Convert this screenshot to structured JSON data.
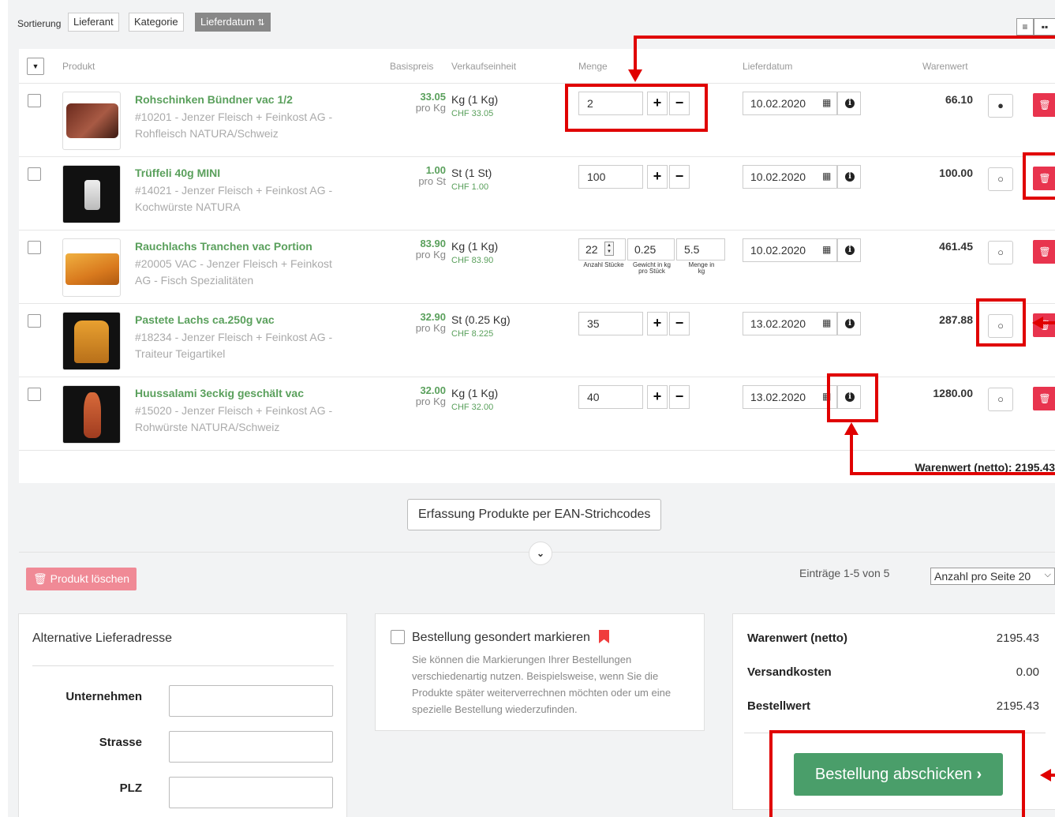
{
  "sort": {
    "label": "Sortierung",
    "buttons": [
      "Lieferant",
      "Kategorie",
      "Lieferdatum"
    ],
    "active_icon": "sort-asc-icon"
  },
  "table": {
    "headers": {
      "product": "Produkt",
      "base_price": "Basispreis",
      "sales_unit": "Verkaufseinheit",
      "quantity": "Menge",
      "delivery_date": "Lieferdatum",
      "goods_value": "Warenwert"
    },
    "rows": [
      {
        "name": "Rohschinken Bündner vac 1/2",
        "desc": "#10201 - Jenzer Fleisch + Feinkost AG - Rohfleisch NATURA/Schweiz",
        "price": "33.05",
        "price_unit": "pro Kg",
        "unit": "Kg (1 Kg)",
        "unit_chf": "CHF 33.05",
        "qty": "2",
        "date": "10.02.2020",
        "value": "66.10",
        "comment": "filled"
      },
      {
        "name": "Trüffeli 40g MINI",
        "desc": "#14021 - Jenzer Fleisch + Feinkost AG - Kochwürste NATURA",
        "price": "1.00",
        "price_unit": "pro St",
        "unit": "St (1 St)",
        "unit_chf": "CHF 1.00",
        "qty": "100",
        "date": "10.02.2020",
        "value": "100.00",
        "comment": "empty"
      },
      {
        "name": "Rauchlachs Tranchen vac Portion",
        "desc": "#20005 VAC - Jenzer Fleisch + Feinkost AG - Fisch Spezialitäten",
        "price": "83.90",
        "price_unit": "pro Kg",
        "unit": "Kg (1 Kg)",
        "unit_chf": "CHF 83.90",
        "qty_pieces": "22",
        "qty_weight": "0.25",
        "qty_kg": "5.5",
        "lbl_pieces": "Anzahl Stücke",
        "lbl_weight": "Gewicht in kg pro Stück",
        "lbl_kg": "Menge in kg",
        "date": "10.02.2020",
        "value": "461.45",
        "comment": "empty"
      },
      {
        "name": "Pastete Lachs ca.250g vac",
        "desc": "#18234 - Jenzer Fleisch + Feinkost AG - Traiteur Teigartikel",
        "price": "32.90",
        "price_unit": "pro Kg",
        "unit": "St (0.25 Kg)",
        "unit_chf": "CHF 8.225",
        "qty": "35",
        "date": "13.02.2020",
        "value": "287.88",
        "comment": "empty"
      },
      {
        "name": "Huussalami 3eckig geschält vac",
        "desc": "#15020 - Jenzer Fleisch + Feinkost AG - Rohwürste NATURA/Schweiz",
        "price": "32.00",
        "price_unit": "pro Kg",
        "unit": "Kg (1 Kg)",
        "unit_chf": "CHF 32.00",
        "qty": "40",
        "date": "13.02.2020",
        "value": "1280.00",
        "comment": "empty"
      }
    ],
    "total_label": "Warenwert (netto): 2195.43"
  },
  "ean_button": "Erfassung Produkte per EAN-Strichcodes",
  "delete_button": "Produkt löschen",
  "entries_info": "Einträge 1-5 von 5",
  "per_page": "Anzahl pro Seite 20",
  "address": {
    "title": "Alternative Lieferadresse",
    "fields": [
      "Unternehmen",
      "Strasse",
      "PLZ"
    ]
  },
  "mark": {
    "label": "Bestellung gesondert markieren",
    "text": "Sie können die Markierungen Ihrer Bestellungen verschiedenartig nutzen. Beispielsweise, wenn Sie die Produkte später weiterverrechnen möchten oder um eine spezielle Bestellung wiederzufinden."
  },
  "summary": {
    "rows": [
      {
        "label": "Warenwert (netto)",
        "value": "2195.43"
      },
      {
        "label": "Versandkosten",
        "value": "0.00"
      },
      {
        "label": "Bestellwert",
        "value": "2195.43"
      }
    ],
    "submit": "Bestellung abschicken"
  },
  "colors": {
    "green": "#5aa05c",
    "red_button": "#e8344e",
    "annotation": "#e00000",
    "submit_green": "#4a9e6a"
  }
}
